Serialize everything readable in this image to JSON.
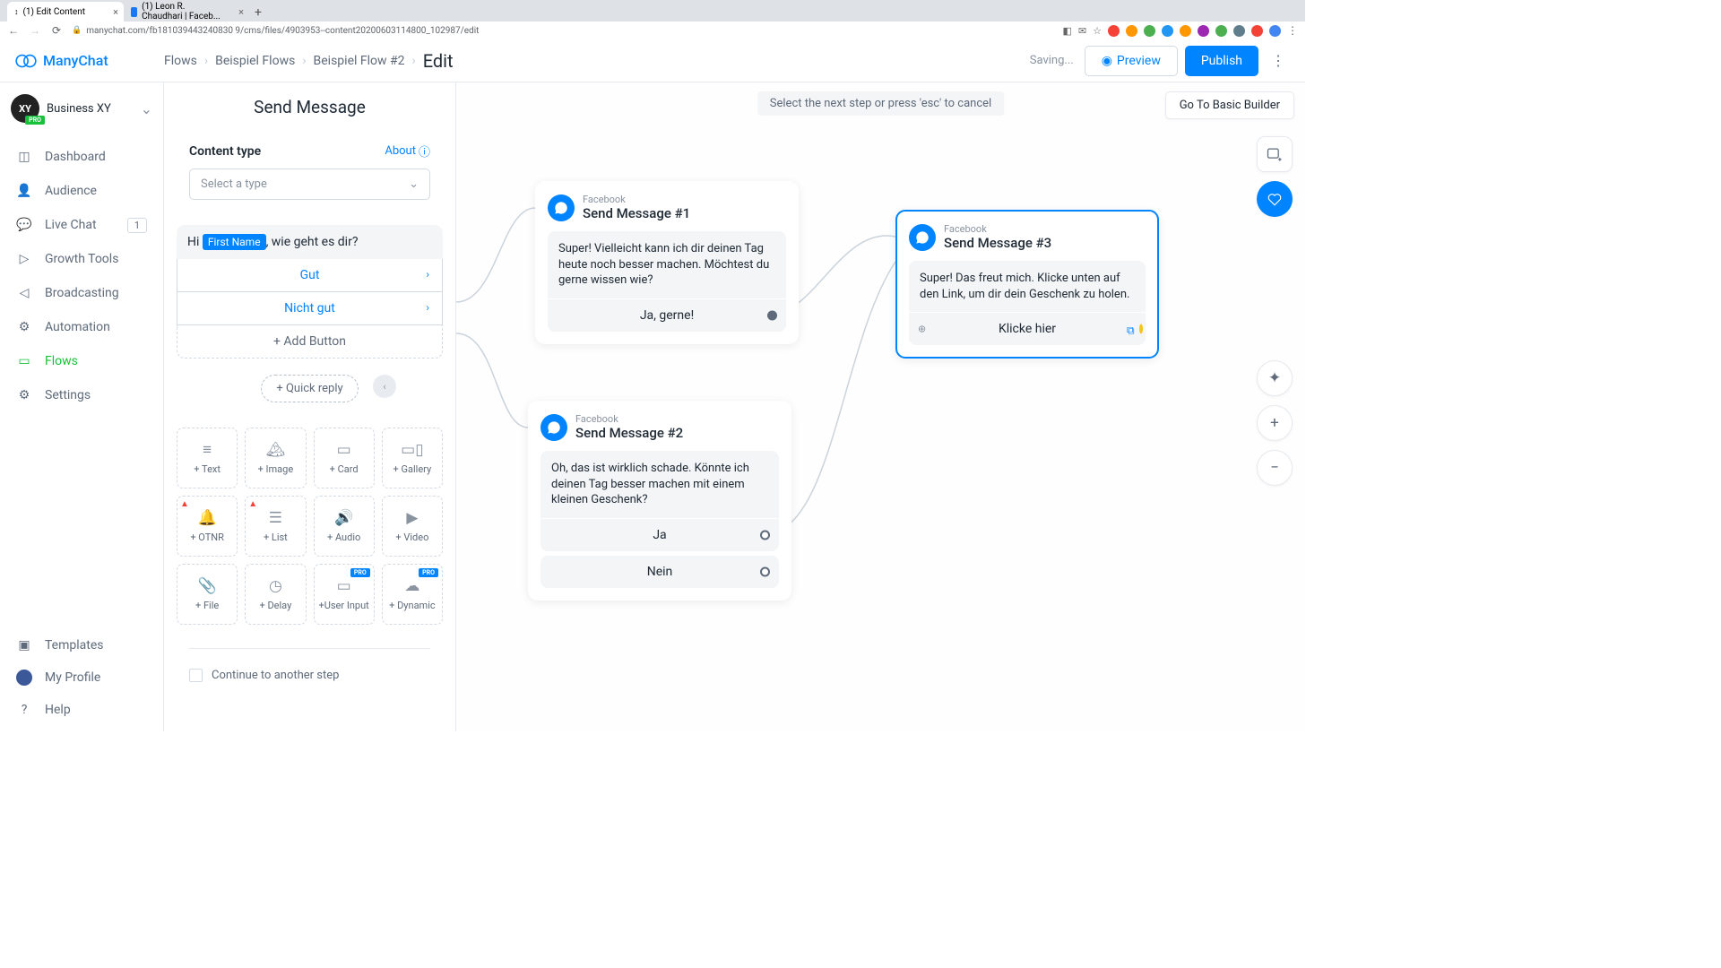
{
  "browser": {
    "tab1": "(1) Edit Content",
    "tab2": "(1) Leon R. Chaudhari | Faceb...",
    "url": "manychat.com/fb181039443240830 9/cms/files/4903953--content20200603114800_102987/edit"
  },
  "header": {
    "logo": "ManyChat",
    "bc1": "Flows",
    "bc2": "Beispiel Flows",
    "bc3": "Beispiel Flow #2",
    "bc4": "Edit",
    "saving": "Saving...",
    "preview": "Preview",
    "publish": "Publish"
  },
  "sidebar": {
    "account": "Business XY",
    "items": {
      "dashboard": "Dashboard",
      "audience": "Audience",
      "livechat": "Live Chat",
      "livechat_badge": "1",
      "growth": "Growth Tools",
      "broadcasting": "Broadcasting",
      "automation": "Automation",
      "flows": "Flows",
      "settings": "Settings",
      "templates": "Templates",
      "profile": "My Profile",
      "help": "Help"
    }
  },
  "editor": {
    "title": "Send Message",
    "content_type": "Content type",
    "about": "About",
    "select_placeholder": "Select a type",
    "msg_prefix": "Hi ",
    "msg_chip": "First Name",
    "msg_suffix": ", wie geht es dir?",
    "reply1": "Gut",
    "reply2": "Nicht gut",
    "add_button": "+ Add Button",
    "quick_reply": "+ Quick reply",
    "grid": {
      "text": "+ Text",
      "image": "+ Image",
      "card": "+ Card",
      "gallery": "+ Gallery",
      "otnr": "+ OTNR",
      "list": "+ List",
      "audio": "+ Audio",
      "video": "+ Video",
      "file": "+ File",
      "delay": "+ Delay",
      "userinput": "+User Input",
      "dynamic": "+ Dynamic"
    },
    "pro": "PRO",
    "continue": "Continue to another step"
  },
  "canvas": {
    "hint": "Select the next step or press 'esc' to cancel",
    "basic_builder": "Go To Basic Builder",
    "node1": {
      "type": "Facebook",
      "title": "Send Message #1",
      "msg": "Super! Vielleicht kann ich dir deinen Tag heute noch besser machen. Möchtest du gerne wissen wie?",
      "btn": "Ja, gerne!"
    },
    "node2": {
      "type": "Facebook",
      "title": "Send Message #2",
      "msg": "Oh, das ist wirklich schade. Könnte ich deinen Tag besser machen mit einem kleinen Geschenk?",
      "btn1": "Ja",
      "btn2": "Nein"
    },
    "node3": {
      "type": "Facebook",
      "title": "Send Message #3",
      "msg": "Super! Das freut mich. Klicke unten auf den Link, um dir dein Geschenk zu holen.",
      "btn": "Klicke hier"
    }
  }
}
